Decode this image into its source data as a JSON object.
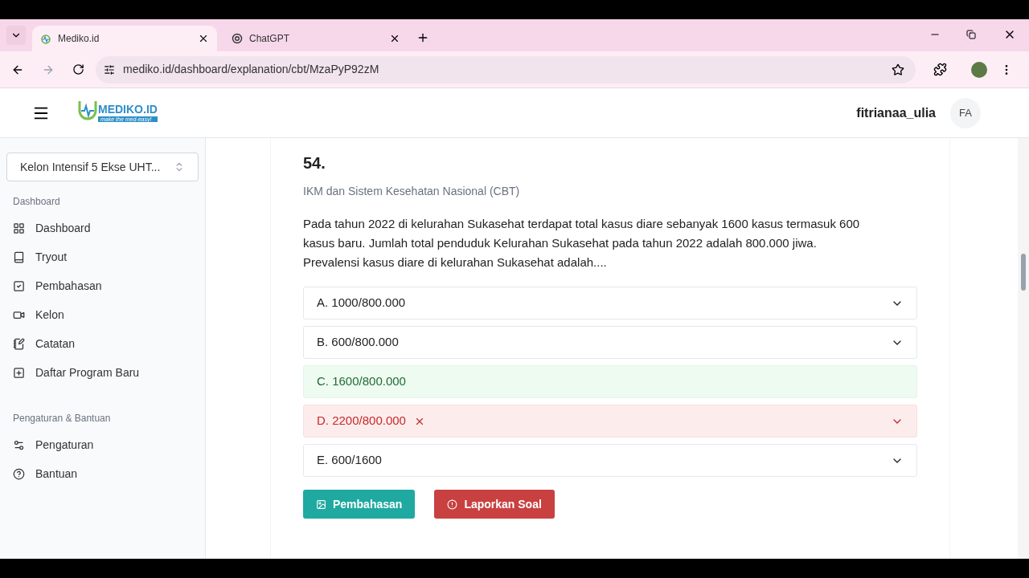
{
  "browser": {
    "tabs": [
      {
        "title": "Mediko.id",
        "selected": true
      },
      {
        "title": "ChatGPT",
        "selected": false
      }
    ],
    "url": "mediko.id/dashboard/explanation/cbt/MzaPyP92zM"
  },
  "header": {
    "logo_title": "MEDIKO.ID",
    "logo_tagline": "make the med-easy!",
    "username": "fitrianaa_ulia",
    "avatar_initials": "FA"
  },
  "sidebar": {
    "program_select": "Kelon Intensif 5 Ekse UHT...",
    "sections": [
      {
        "title": "Dashboard",
        "items": [
          {
            "label": "Dashboard"
          },
          {
            "label": "Tryout"
          },
          {
            "label": "Pembahasan"
          },
          {
            "label": "Kelon"
          },
          {
            "label": "Catatan"
          },
          {
            "label": "Daftar Program Baru"
          }
        ]
      },
      {
        "title": "Pengaturan & Bantuan",
        "items": [
          {
            "label": "Pengaturan"
          },
          {
            "label": "Bantuan"
          }
        ]
      }
    ]
  },
  "question": {
    "number": "54.",
    "category": "IKM dan Sistem Kesehatan Nasional (CBT)",
    "text": [
      "Pada tahun 2022 di kelurahan Sukasehat terdapat total kasus diare sebanyak 1600 kasus termasuk 600 kasus baru. Jumlah total penduduk Kelurahan Sukasehat pada tahun 2022 adalah 800.000 jiwa.",
      "Prevalensi kasus diare di kelurahan Sukasehat adalah...."
    ],
    "options": [
      {
        "label": "A. 1000/800.000",
        "kind": "neutral"
      },
      {
        "label": "B. 600/800.000",
        "kind": "neutral"
      },
      {
        "label": "C. 1600/800.000",
        "kind": "correct"
      },
      {
        "label": "D. 2200/800.000",
        "kind": "wrong"
      },
      {
        "label": "E. 600/1600",
        "kind": "neutral"
      }
    ],
    "buttons": [
      {
        "label": "Pembahasan",
        "kind": "primary"
      },
      {
        "label": "Laporkan Soal",
        "kind": "danger"
      }
    ]
  }
}
